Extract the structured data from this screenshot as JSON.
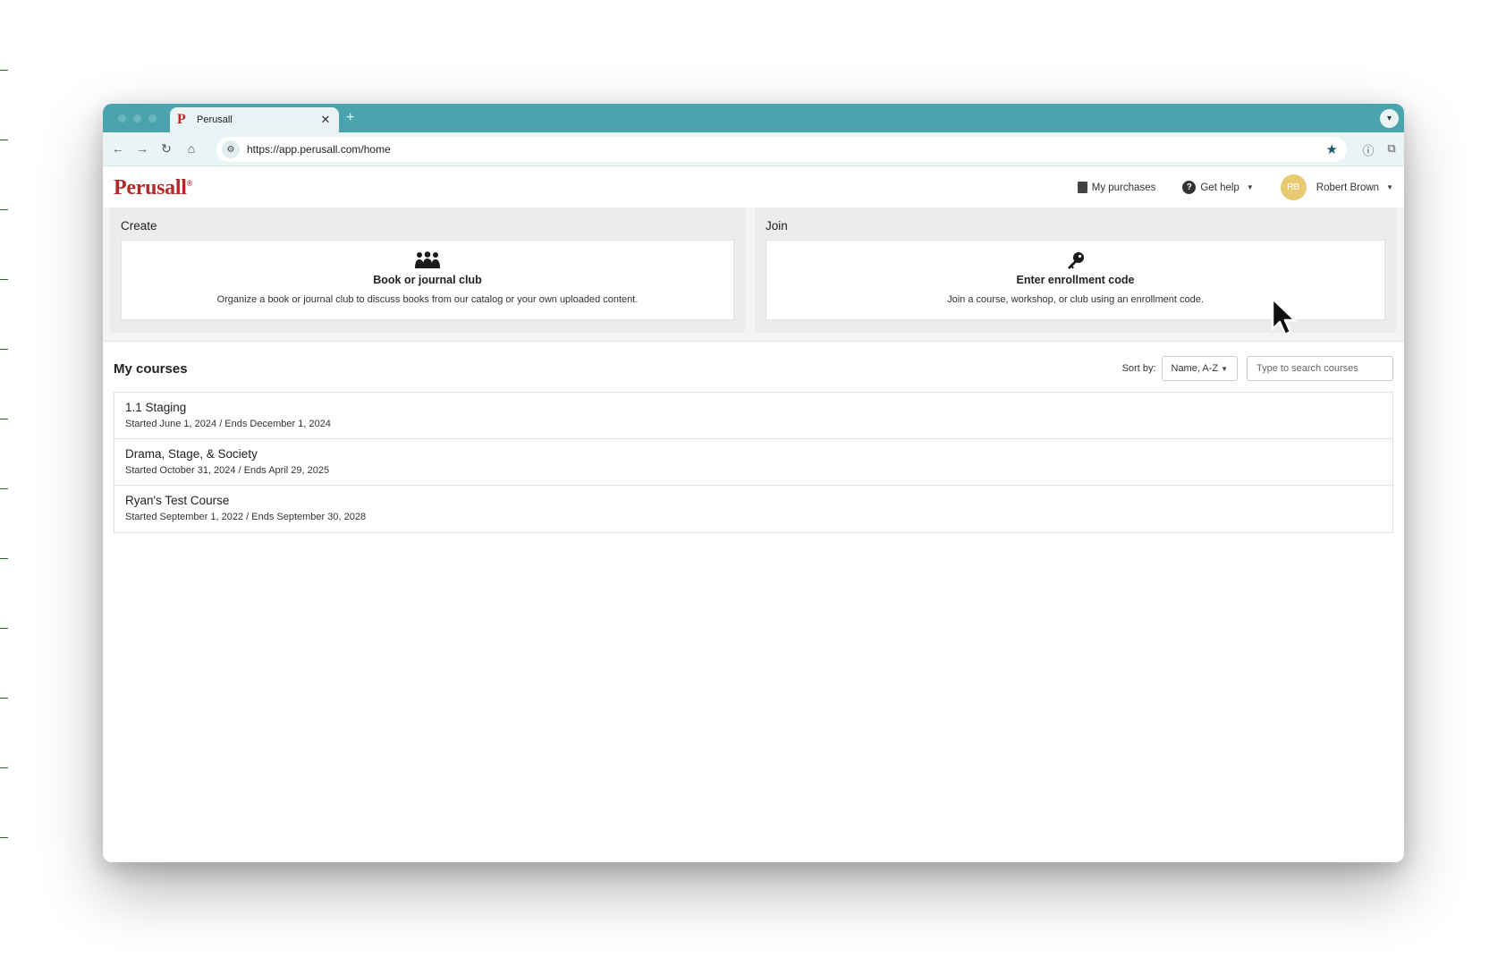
{
  "browser": {
    "tab_title": "Perusall",
    "tab_favicon": "P",
    "tab_close": "✕",
    "new_tab": "+",
    "url": "https://app.perusall.com/home"
  },
  "header": {
    "logo": "Perusall",
    "logo_mark": "®",
    "my_purchases": "My purchases",
    "get_help": "Get help",
    "user_initials": "RB",
    "user_name": "Robert Brown"
  },
  "create": {
    "title": "Create",
    "card_title": "Book or journal club",
    "card_desc": "Organize a book or journal club to discuss books from our catalog or your own uploaded content.",
    "icon": "group-icon"
  },
  "join": {
    "title": "Join",
    "card_title": "Enter enrollment code",
    "card_desc": "Join a course, workshop, or club using an enrollment code.",
    "icon": "key-icon"
  },
  "courses": {
    "heading": "My courses",
    "sort_label": "Sort by:",
    "sort_value": "Name, A-Z",
    "search_placeholder": "Type to search courses",
    "items": [
      {
        "name": "1.1 Staging",
        "dates": "Started June 1, 2024 / Ends December 1, 2024"
      },
      {
        "name": "Drama, Stage, & Society",
        "dates": "Started October 31, 2024 / Ends April 29, 2025"
      },
      {
        "name": "Ryan's Test Course",
        "dates": "Started September 1, 2022 / Ends September 30, 2028"
      }
    ]
  },
  "colors": {
    "tabstrip": "#4aa3ad",
    "toolbar": "#eaf4f5",
    "brand": "#b22b2b",
    "avatar": "#e9c972"
  }
}
